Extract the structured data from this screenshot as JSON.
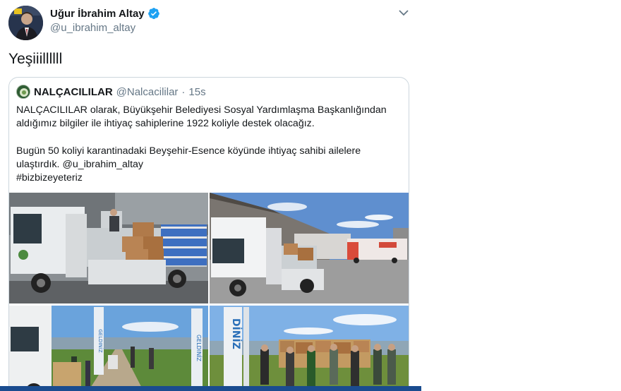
{
  "author": {
    "name": "Uğur İbrahim Altay",
    "handle": "@u_ibrahim_altay"
  },
  "tweet": {
    "text": "Yeşiiillllll"
  },
  "quoted": {
    "name": "NALÇACILILAR",
    "handle": "@Nalcacililar",
    "separator": "·",
    "time": "15s",
    "lines": [
      "NALÇACILILAR olarak, Büyükşehir Belediyesi Sosyal Yardımlaşma Başkanlığından",
      "aldığımız bilgiler ile ihtiyaç sahiplerine 1922 koliyle destek olacağız.",
      "",
      "Bugün 50 koliyi karantinadaki Beyşehir-Esence köyünde ihtiyaç sahibi ailelere",
      "ulaştırdık. @u_ibrahim_altay",
      "#bizbizeyeteriz"
    ]
  },
  "icons": {
    "verified": "verified-badge-icon",
    "more": "chevron-down-icon"
  },
  "colors": {
    "verified": "#1da1f2",
    "border": "#ccd6dd",
    "secondary_text": "#657786",
    "bottom_bar": "#1a4c8f"
  },
  "photo_texts": {
    "banner_left": "GELDINİZ",
    "banner_right": "GELDINİZ",
    "banner_big": "DİNİZ"
  }
}
